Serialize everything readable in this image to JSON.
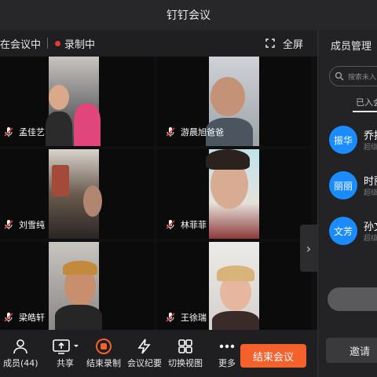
{
  "window": {
    "title": "钉钉会议"
  },
  "status": {
    "in_meeting": "在会议中",
    "recording": "录制中",
    "fullscreen": "全屏"
  },
  "colors": {
    "accent": "#f5612d",
    "record_dot": "#e53935",
    "avatar_blue": "#1a8cff"
  },
  "participants": [
    {
      "name": "孟佳艺",
      "muted": true
    },
    {
      "name": "游晨旭爸爸",
      "muted": true
    },
    {
      "name": "刘雪纯",
      "muted": true
    },
    {
      "name": "林菲菲",
      "muted": true
    },
    {
      "name": "梁皓轩",
      "muted": true
    },
    {
      "name": "王徐瑞",
      "muted": true
    }
  ],
  "toolbar": {
    "members_label": "成员(44)",
    "share_label": "共享",
    "end_record_label": "结束录制",
    "minutes_label": "会议纪要",
    "switch_view_label": "切换视图",
    "more_label": "更多",
    "end_meeting_label": "结束会议"
  },
  "panel": {
    "title": "成员管理",
    "search_placeholder": "搜索未入",
    "joined_tab": "已入会",
    "members": [
      {
        "avatar": "振华",
        "name": "乔振",
        "role": "超级"
      },
      {
        "avatar": "丽丽",
        "name": "时丽",
        "role": "超级"
      },
      {
        "avatar": "文芳",
        "name": "孙文",
        "role": "超级"
      }
    ],
    "invite_label": "邀请"
  }
}
